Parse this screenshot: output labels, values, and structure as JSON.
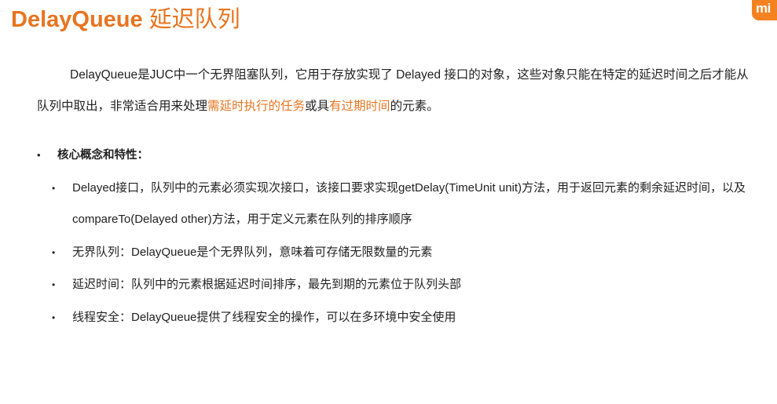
{
  "slide": {
    "title_en": "DelayQueue",
    "title_zh": "延迟队列",
    "logo_text": "mi",
    "accent_color": "#e8741f"
  },
  "intro": {
    "part1": "DelayQueue是JUC中一个无界阻塞队列，它用于存放实现了 Delayed 接口的对象，这些对象只能在特定的延迟时间之后才能从队列中取出，非常适合用来处理",
    "highlight1": "需延时执行的任务",
    "part2": "或具",
    "highlight2": "有过期时间",
    "part3": "的元素。"
  },
  "section": {
    "bullet_symbol": "•",
    "heading": "核心概念和特性：",
    "items": [
      {
        "text": "Delayed接口，队列中的元素必须实现次接口，该接口要求实现getDelay(TimeUnit unit)方法，用于返回元素的剩余延迟时间，以及compareTo(Delayed other)方法，用于定义元素在队列的排序顺序"
      },
      {
        "text": "无界队列：DelayQueue是个无界队列，意味着可存储无限数量的元素"
      },
      {
        "text": "延迟时间：队列中的元素根据延迟时间排序，最先到期的元素位于队列头部"
      },
      {
        "text": "线程安全：DelayQueue提供了线程安全的操作，可以在多环境中安全使用"
      }
    ]
  }
}
